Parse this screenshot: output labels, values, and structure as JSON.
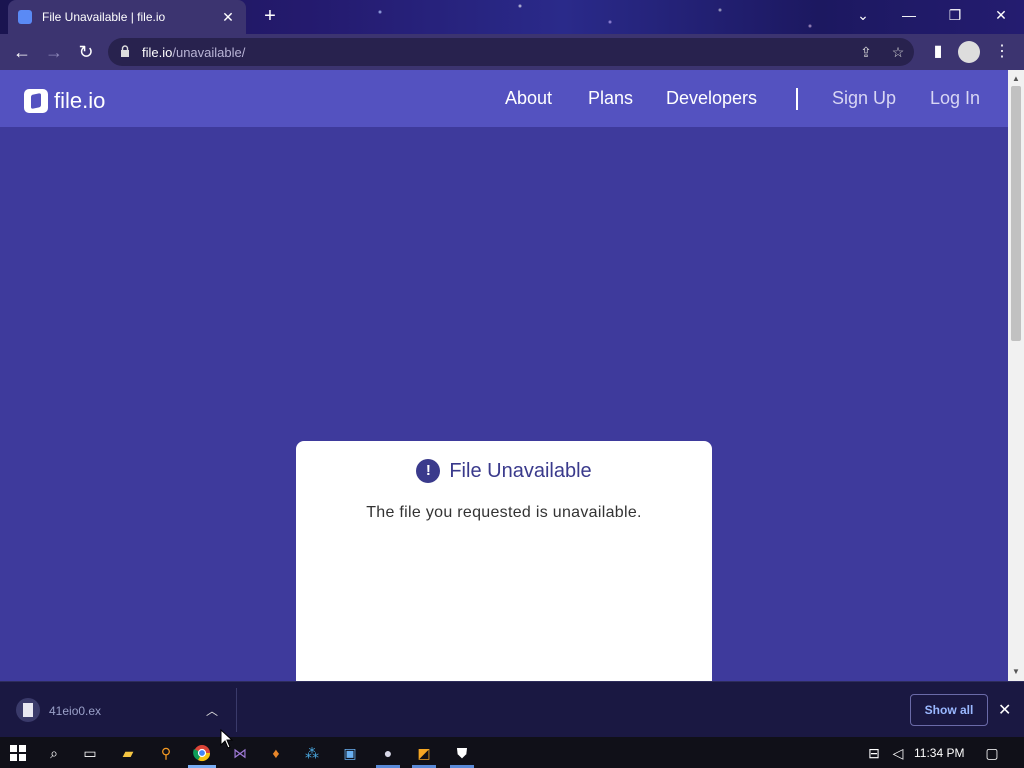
{
  "browser": {
    "tab_title": "File Unavailable | file.io",
    "url_host": "file.io",
    "url_path": "/unavailable/"
  },
  "site": {
    "logo_text": "file.io",
    "nav": {
      "about": "About",
      "plans": "Plans",
      "developers": "Developers",
      "signup": "Sign Up",
      "login": "Log In"
    }
  },
  "card": {
    "title": "File Unavailable",
    "message": "The file you requested is unavailable."
  },
  "download_shelf": {
    "filename": "41eio0.ex",
    "show_all": "Show all"
  },
  "taskbar": {
    "clock": "11:34 PM"
  },
  "colors": {
    "page_bg": "#3e3a9c",
    "nav_bg": "#5452c0",
    "accent": "#3a3a8c"
  }
}
